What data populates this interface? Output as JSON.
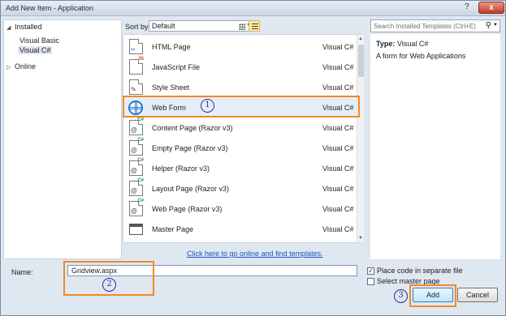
{
  "window": {
    "title": "Add New Item - Application",
    "help_label": "?",
    "close_label": "x"
  },
  "tree": {
    "installed": "Installed",
    "visual_basic": "Visual Basic",
    "visual_csharp": "Visual C#",
    "online": "Online"
  },
  "toolbar": {
    "sort_label": "Sort by:",
    "sort_value": "Default"
  },
  "items": [
    {
      "name": "HTML Page",
      "lang": "Visual C#",
      "icon": "html-page-icon"
    },
    {
      "name": "JavaScript File",
      "lang": "Visual C#",
      "icon": "javascript-file-icon"
    },
    {
      "name": "Style Sheet",
      "lang": "Visual C#",
      "icon": "style-sheet-icon"
    },
    {
      "name": "Web Form",
      "lang": "Visual C#",
      "icon": "globe-icon"
    },
    {
      "name": "Content Page (Razor v3)",
      "lang": "Visual C#",
      "icon": "razor-page-icon"
    },
    {
      "name": "Empty Page (Razor v3)",
      "lang": "Visual C#",
      "icon": "razor-page-icon"
    },
    {
      "name": "Helper (Razor v3)",
      "lang": "Visual C#",
      "icon": "razor-page-icon"
    },
    {
      "name": "Layout Page (Razor v3)",
      "lang": "Visual C#",
      "icon": "razor-page-icon"
    },
    {
      "name": "Web Page (Razor v3)",
      "lang": "Visual C#",
      "icon": "razor-page-icon"
    },
    {
      "name": "Master Page",
      "lang": "Visual C#",
      "icon": "master-page-icon"
    }
  ],
  "online_link": "Click here to go online and find templates.",
  "search": {
    "placeholder": "Search Installed Templates (Ctrl+E)"
  },
  "details": {
    "type_label": "Type:",
    "type_value": "Visual C#",
    "description": "A form for Web Applications"
  },
  "name_field": {
    "label": "Name:",
    "value": "Gridview.aspx"
  },
  "options": {
    "separate_file": "Place code in separate file",
    "master_page": "Select master page"
  },
  "buttons": {
    "add": "Add",
    "cancel": "Cancel"
  },
  "annotations": {
    "step1": "1",
    "step2": "2",
    "step3": "3"
  },
  "colors": {
    "highlight": "#f08a24",
    "step_circle": "#2a2f9c",
    "link": "#1a55c4"
  }
}
